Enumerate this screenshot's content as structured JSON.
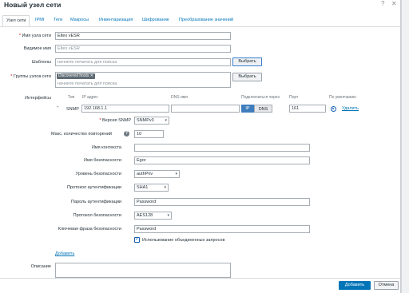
{
  "dialog": {
    "title": "Новый узел сети",
    "help_icon": "question-icon",
    "close_icon": "close-icon"
  },
  "tabs": [
    {
      "label": "Узел сети",
      "active": true
    },
    {
      "label": "IPMI"
    },
    {
      "label": "Теги"
    },
    {
      "label": "Макросы"
    },
    {
      "label": "Инвентаризация"
    },
    {
      "label": "Шифрование"
    },
    {
      "label": "Преобразование значений"
    }
  ],
  "host": {
    "name_label": "Имя узла сети",
    "name_value": "Eltex vESR",
    "visible_label": "Видимое имя",
    "visible_value": "Eltex vESR",
    "templates_label": "Шаблоны",
    "templates_placeholder": "начните печатать для поиска",
    "select_button": "Выбрать",
    "groups_label": "Группы узлов сети",
    "group_tag": "Discovered hosts",
    "groups_placeholder": "начните печатать для поиска",
    "groups_select_button": "Выбрать"
  },
  "interfaces": {
    "label": "Интерфейсы",
    "headers": {
      "type": "Тип",
      "ip": "IP адрес",
      "dns": "DNS имя",
      "connect": "Подключаться через",
      "port": "Порт",
      "default": "По умолчанию"
    },
    "row": {
      "type": "SNMP",
      "ip": "192.168.1.1",
      "dns": "",
      "ip_btn": "IP",
      "dns_btn": "DNS",
      "port": "161",
      "remove": "Удалить"
    },
    "add": "Добавить"
  },
  "snmp": {
    "version_label": "Версия SNMP",
    "version_value": "SNMPv3",
    "max_rep_label": "Макс. количество повторений",
    "max_rep_value": "10",
    "context_label": "Имя контекста",
    "context_value": "",
    "security_name_label": "Имя безопасности",
    "security_name_value": "Egor",
    "security_level_label": "Уровень безопасности",
    "security_level_value": "authPriv",
    "auth_protocol_label": "Протокол аутентификации",
    "auth_protocol_value": "SHA1",
    "auth_pass_label": "Пароль аутентификации",
    "auth_pass_value": "Password",
    "priv_protocol_label": "Протокол безопасности",
    "priv_protocol_value": "AES128",
    "priv_pass_label": "Ключевая фраза безопасности",
    "priv_pass_value": "Password",
    "bulk_label": "Использование объединенных запросов",
    "bulk_checked": true
  },
  "description_label": "Описание",
  "footer": {
    "add_button": "Добавить",
    "cancel_button": "Отмена"
  },
  "colors": {
    "accent": "#0275b8",
    "required": "#d40000",
    "tag": "#5f6b74"
  }
}
